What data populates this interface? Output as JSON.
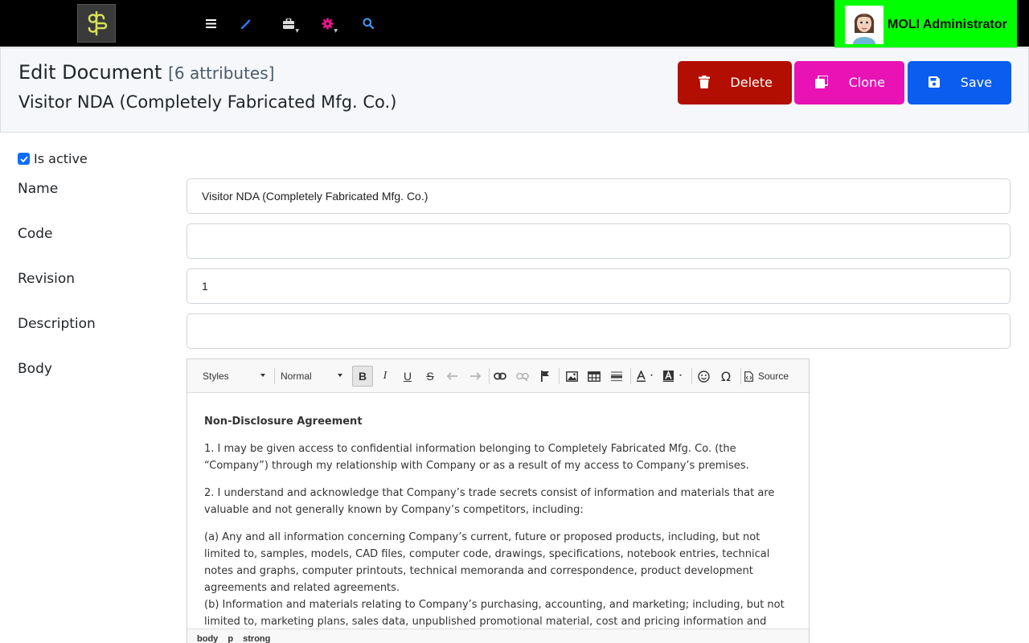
{
  "topbar": {
    "icons": [
      "logo-icon",
      "menu-icon",
      "magic-wand-icon",
      "toolbox-icon",
      "gear-icon",
      "search-icon"
    ],
    "user_name": "MOLI Administrator",
    "colors": {
      "bar": "#000000",
      "user_box": "#00ff00",
      "logo": "#d4e157"
    }
  },
  "header": {
    "title": "Edit Document",
    "attributes": "[6 attributes]",
    "subtitle": "Visitor NDA (Completely Fabricated Mfg. Co.)",
    "buttons": {
      "delete": "Delete",
      "clone": "Clone",
      "save": "Save"
    },
    "colors": {
      "delete": "#b30e02",
      "clone": "#e812b5",
      "save": "#0b5df0"
    }
  },
  "form": {
    "is_active": {
      "label": "Is active",
      "checked": true
    },
    "name": {
      "label": "Name",
      "value": "Visitor NDA (Completely Fabricated Mfg. Co.)"
    },
    "code": {
      "label": "Code",
      "value": ""
    },
    "revision": {
      "label": "Revision",
      "value": "1"
    },
    "description": {
      "label": "Description",
      "value": ""
    },
    "body": {
      "label": "Body"
    }
  },
  "editor": {
    "styles_combo": "Styles",
    "format_combo": "Normal",
    "source_label": "Source",
    "toolbar_icons": [
      "bold-icon",
      "italic-icon",
      "underline-icon",
      "strike-icon",
      "undo-icon",
      "redo-icon",
      "link-icon",
      "unlink-icon",
      "anchor-icon",
      "image-icon",
      "table-icon",
      "horizontal-line-icon",
      "text-color-icon",
      "background-color-icon",
      "smiley-icon",
      "special-char-icon",
      "source-icon"
    ],
    "heading": "Non-Disclosure Agreement",
    "para1": "1. I may be given access to confidential information belonging to Completely Fabricated Mfg. Co. (the “Company”) through my relationship with Company or as a result of my access to Company’s premises.",
    "para2": "2. I understand and acknowledge that Company’s trade secrets consist of information and materials that are valuable and not generally known by Company’s competitors, including:",
    "item_a": "(a) Any and all information concerning Company’s current, future or proposed products, including, but not limited to, samples, models, CAD files, computer code, drawings, specifications, notebook entries, technical notes and graphs, computer printouts, technical memoranda and correspondence, product development agreements and related agreements.",
    "item_b": "(b) Information and materials relating to Company’s purchasing, accounting, and marketing; including, but not limited to, marketing plans, sales data, unpublished promotional material, cost and pricing information and customer lists.",
    "path": [
      "body",
      "p",
      "strong"
    ]
  }
}
